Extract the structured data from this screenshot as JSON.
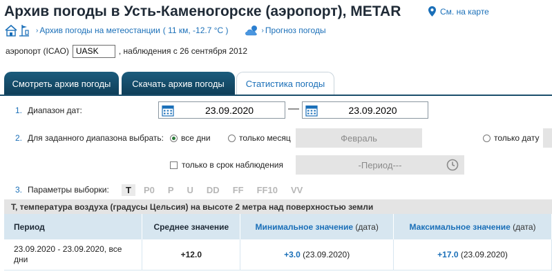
{
  "header": {
    "title": "Архив погоды в Усть-Каменогорске (аэропорт), METAR",
    "map_link": "См. на карте"
  },
  "subnav": {
    "station_link": "Архив погоды на метеостанции",
    "station_info": "( 11 км, -12.7 °C )",
    "forecast_link": "Прогноз погоды"
  },
  "icao": {
    "label": "аэропорт (ICAO)",
    "value": "UASK",
    "since": ", наблюдения с 26 сентября 2012"
  },
  "tabs": [
    {
      "label": "Смотреть архив погоды",
      "active": false
    },
    {
      "label": "Скачать архив погоды",
      "active": false
    },
    {
      "label": "Статистика погоды",
      "active": true
    }
  ],
  "form": {
    "row1": {
      "num": "1.",
      "label": "Диапазон дат:",
      "date_from": "23.09.2020",
      "date_to": "23.09.2020"
    },
    "row2": {
      "num": "2.",
      "label": "Для заданного диапазона выбрать:",
      "opt_all": "все дни",
      "opt_month": "только месяц",
      "month_value": "Февраль",
      "opt_date": "только дату",
      "check_obs": "только в срок наблюдения",
      "period_value": "-Период---"
    },
    "row3": {
      "num": "3.",
      "label": "Параметры выборки:",
      "params": [
        "T",
        "P0",
        "P",
        "U",
        "DD",
        "FF",
        "FF10",
        "VV"
      ],
      "selected": "T"
    }
  },
  "description": "T, температура воздуха (градусы Цельсия) на высоте 2 метра над поверхностью земли",
  "table": {
    "headers": {
      "period": "Период",
      "avg": "Среднее значение",
      "min": "Минимальное значение",
      "min_suffix": "(дата)",
      "max": "Максимальное значение",
      "max_suffix": "(дата)"
    },
    "rows": [
      {
        "period_line1": "23.09.2020 - 23.09.2020, все",
        "period_line2": "дни",
        "avg": "+12.0",
        "min": "+3.0",
        "min_date": "(23.09.2020)",
        "max": "+17.0",
        "max_date": "(23.09.2020)"
      }
    ]
  },
  "colors": {
    "accent": "#1a6fb8",
    "tab_dark": "#0f3e58",
    "header_row": "#d7e6f0"
  }
}
